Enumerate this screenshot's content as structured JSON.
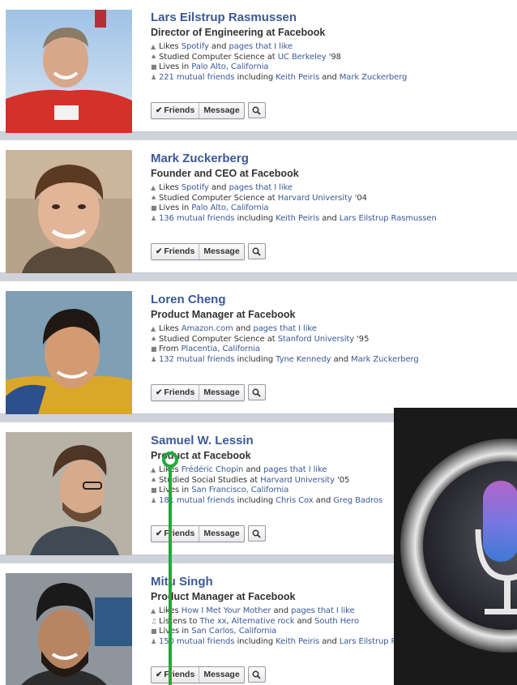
{
  "cards": [
    {
      "name": "Lars Eilstrup Rasmussen",
      "title": "Director of Engineering at Facebook",
      "lines": [
        {
          "icon": "like-icon",
          "pre": "Likes ",
          "l1": "Spotify",
          "mid": " and ",
          "l2": "pages that I like",
          "post": ""
        },
        {
          "icon": "school-icon",
          "pre": "Studied Computer Science at ",
          "l1": "UC Berkeley",
          "mid": " '98",
          "l2": "",
          "post": ""
        },
        {
          "icon": "home-icon",
          "pre": "Lives in ",
          "l1": "Palo Alto, California",
          "mid": "",
          "l2": "",
          "post": ""
        },
        {
          "icon": "friends-icon",
          "pre": "",
          "l1": "221 mutual friends",
          "mid": " including ",
          "l2": "Keith Peiris",
          "post": " and ",
          "l3": "Mark Zuckerberg"
        }
      ]
    },
    {
      "name": "Mark Zuckerberg",
      "title": "Founder and CEO at Facebook",
      "lines": [
        {
          "icon": "like-icon",
          "pre": "Likes ",
          "l1": "Spotify",
          "mid": " and ",
          "l2": "pages that I like",
          "post": ""
        },
        {
          "icon": "school-icon",
          "pre": "Studied Computer Science at ",
          "l1": "Harvard University",
          "mid": " '04",
          "l2": "",
          "post": ""
        },
        {
          "icon": "home-icon",
          "pre": "Lives in ",
          "l1": "Palo Alto, California",
          "mid": "",
          "l2": "",
          "post": ""
        },
        {
          "icon": "friends-icon",
          "pre": "",
          "l1": "136 mutual friends",
          "mid": " including ",
          "l2": "Keith Peiris",
          "post": " and ",
          "l3": "Lars Eilstrup Rasmussen"
        }
      ]
    },
    {
      "name": "Loren Cheng",
      "title": "Product Manager at Facebook",
      "lines": [
        {
          "icon": "like-icon",
          "pre": "Likes ",
          "l1": "Amazon.com",
          "mid": " and ",
          "l2": "pages that I like",
          "post": ""
        },
        {
          "icon": "school-icon",
          "pre": "Studied Computer Science at ",
          "l1": "Stanford University",
          "mid": " '95",
          "l2": "",
          "post": ""
        },
        {
          "icon": "home-icon",
          "pre": "From ",
          "l1": "Placentia, California",
          "mid": "",
          "l2": "",
          "post": ""
        },
        {
          "icon": "friends-icon",
          "pre": "",
          "l1": "132 mutual friends",
          "mid": " including ",
          "l2": "Tyne Kennedy",
          "post": " and ",
          "l3": "Mark Zuckerberg"
        }
      ]
    },
    {
      "name": "Samuel W. Lessin",
      "title": "Product at Facebook",
      "lines": [
        {
          "icon": "like-icon",
          "pre": "Likes ",
          "l1": "Frédéric Chopin",
          "mid": " and ",
          "l2": "pages that I like",
          "post": ""
        },
        {
          "icon": "school-icon",
          "pre": "Studied Social Studies at ",
          "l1": "Harvard University",
          "mid": " '05",
          "l2": "",
          "post": ""
        },
        {
          "icon": "home-icon",
          "pre": "Lives in ",
          "l1": "San Francisco, California",
          "mid": "",
          "l2": "",
          "post": ""
        },
        {
          "icon": "friends-icon",
          "pre": "",
          "l1": "181 mutual friends",
          "mid": " including ",
          "l2": "Chris Cox",
          "post": " and ",
          "l3": "Greg Badros"
        }
      ]
    },
    {
      "name": "Mitu Singh",
      "title": "Product Manager at Facebook",
      "lines": [
        {
          "icon": "like-icon",
          "pre": "Likes ",
          "l1": "How I Met Your Mother",
          "mid": " and ",
          "l2": "pages that I like",
          "post": ""
        },
        {
          "icon": "music-icon",
          "pre": "Listens to ",
          "l1": "The xx",
          "mid": ", ",
          "l2": "Alternative rock",
          "post": " and ",
          "l3": "South Hero"
        },
        {
          "icon": "home-icon",
          "pre": "Lives in ",
          "l1": "San Carlos, California",
          "mid": "",
          "l2": "",
          "post": ""
        },
        {
          "icon": "friends-icon",
          "pre": "",
          "l1": "150 mutual friends",
          "mid": " including ",
          "l2": "Keith Peiris",
          "post": " and ",
          "l3": "Lars Eilstrup Rasmussen"
        }
      ]
    }
  ],
  "buttons": {
    "friends": "Friends",
    "message": "Message"
  },
  "colors": {
    "link": "#3b5998",
    "pointer": "#1faa3a",
    "background": "#cdd2db"
  }
}
